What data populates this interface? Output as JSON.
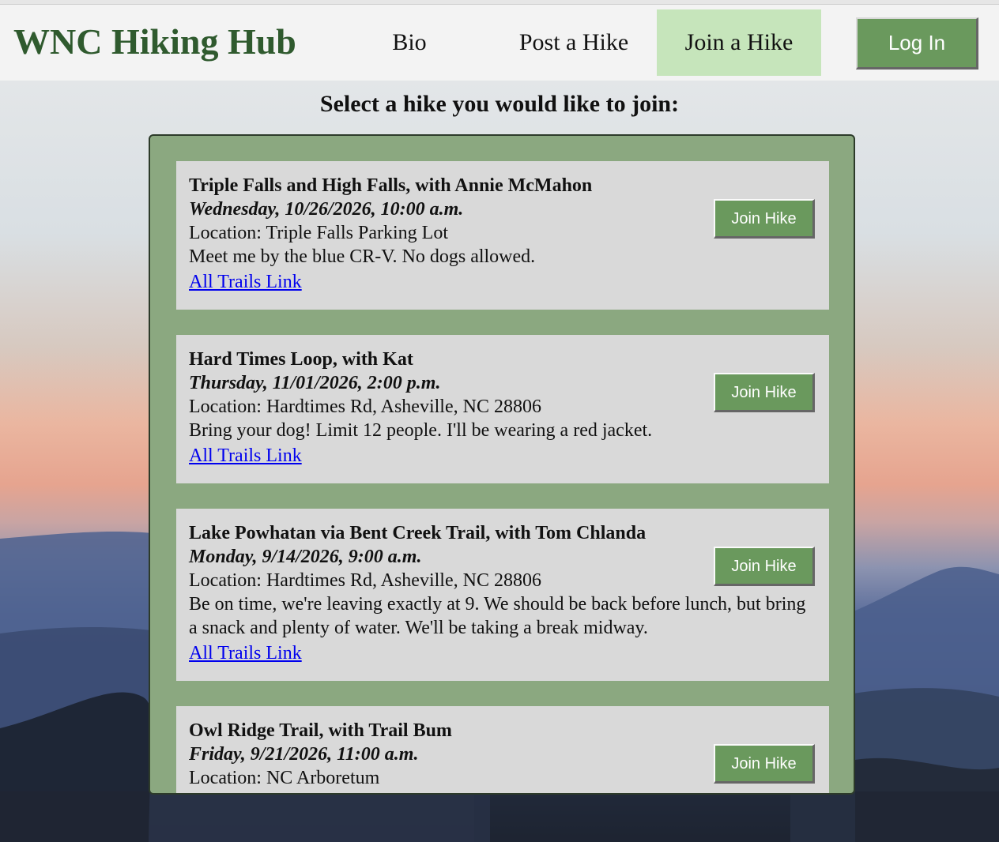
{
  "header": {
    "brand": "WNC Hiking Hub",
    "nav": [
      {
        "label": "Bio"
      },
      {
        "label": "Post a Hike"
      },
      {
        "label": "Join a Hike",
        "active": true
      }
    ],
    "login_label": "Log In"
  },
  "main": {
    "heading": "Select a hike you would like to join:",
    "hikes": [
      {
        "title": "Triple Falls and High Falls, with Annie McMahon",
        "when": "Wednesday, 10/26/2026, 10:00 a.m.",
        "location": "Location: Triple Falls Parking Lot",
        "description": "Meet me by the blue CR-V. No dogs allowed.",
        "link_label": "All Trails Link",
        "button_label": "Join Hike"
      },
      {
        "title": "Hard Times Loop, with Kat",
        "when": "Thursday, 11/01/2026, 2:00 p.m.",
        "location": "Location: Hardtimes Rd, Asheville, NC 28806",
        "description": "Bring your dog! Limit 12 people. I'll be wearing a red jacket.",
        "link_label": "All Trails Link",
        "button_label": "Join Hike"
      },
      {
        "title": "Lake Powhatan via Bent Creek Trail, with Tom Chlanda",
        "when": "Monday, 9/14/2026, 9:00 a.m.",
        "location": "Location: Hardtimes Rd, Asheville, NC 28806",
        "description": "Be on time, we're leaving exactly at 9. We should be back before lunch, but bring a snack and plenty of water. We'll be taking a break midway.",
        "link_label": "All Trails Link",
        "button_label": "Join Hike"
      },
      {
        "title": "Owl Ridge Trail, with Trail Bum",
        "when": "Friday, 9/21/2026, 11:00 a.m.",
        "location": "Location: NC Arboretum",
        "button_label": "Join Hike"
      }
    ]
  },
  "colors": {
    "brand_green": "#2f5a2e",
    "button_green": "#6a995d",
    "active_tab": "#c6e5bb",
    "panel_green": "#8ba880",
    "card_gray": "#d9d9d9",
    "link_blue": "#0000ee"
  }
}
